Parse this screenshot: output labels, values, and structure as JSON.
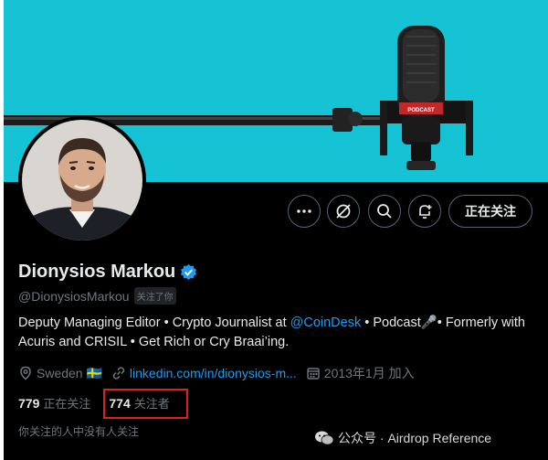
{
  "profile": {
    "display_name": "Dionysios Markou",
    "handle": "@DionysiosMarkou",
    "follows_you_badge": "关注了你",
    "bio_part1": "Deputy Managing Editor • Crypto Journalist at ",
    "bio_mention": "@CoinDesk",
    "bio_part2": " • Podcast🎤• Formerly with Acuris and CRISIL • Get Rich or Cry Braai’ing.",
    "location": "Sweden 🇸🇪",
    "link": "linkedin.com/in/dionysios-m...",
    "joined": "2013年1月 加入",
    "following_count": "779",
    "following_label": "正在关注",
    "followers_count": "774",
    "followers_label": "关注者",
    "followed_by_note": "你关注的人中没有人关注"
  },
  "banner": {
    "podcast_label": "PODCAST",
    "background_color": "#15c3d4"
  },
  "actions": {
    "more_icon": "more-icon",
    "grok_icon": "grok-icon",
    "search_icon": "search-icon",
    "notify_icon": "bell-plus-icon",
    "follow_button_label": "正在关注"
  },
  "watermark": {
    "text": "公众号 · Airdrop Reference"
  },
  "colors": {
    "accent": "#1d9bf0",
    "highlight_box": "#e0201c",
    "muted_text": "#71767b"
  }
}
